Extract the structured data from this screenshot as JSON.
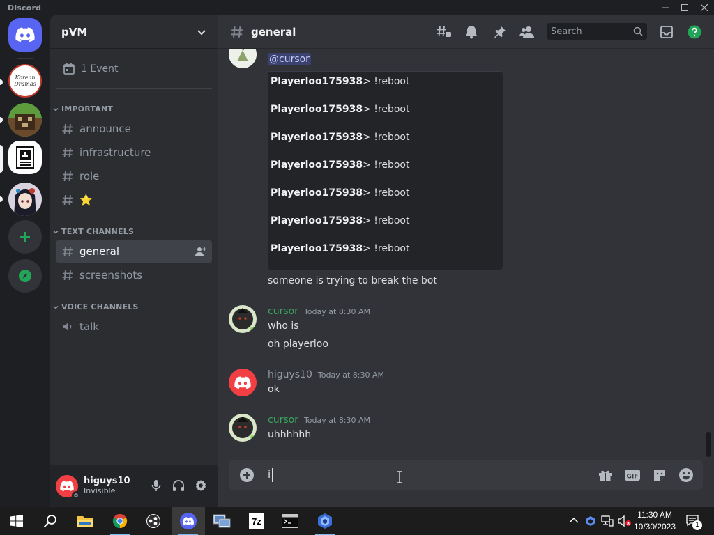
{
  "window": {
    "title": "Discord"
  },
  "colors": {
    "blurple": "#5865f2",
    "green": "#23a559",
    "red": "#f23f43",
    "cursor_author": "#3ba55c",
    "higuys_author": "#949ba4"
  },
  "rail": {
    "servers": [
      {
        "name": "Korean Dramas",
        "icon_text": "Korean Dramas",
        "unread": true
      },
      {
        "name": "pixel-creeper-server",
        "icon_text": "",
        "unread": true
      },
      {
        "name": "pVM",
        "icon_text": "",
        "selected": true
      },
      {
        "name": "anime-server",
        "icon_text": "",
        "unread": true
      }
    ],
    "add_server": "add-server-icon",
    "explore": "compass-icon"
  },
  "sidebar": {
    "server_name": "pVM",
    "events_label": "1 Event",
    "categories": [
      {
        "name": "IMPORTANT",
        "channels": [
          {
            "name": "announce"
          },
          {
            "name": "infrastructure"
          },
          {
            "name": "role"
          },
          {
            "name": "⭐"
          }
        ]
      },
      {
        "name": "TEXT CHANNELS",
        "channels": [
          {
            "name": "general",
            "active": true
          },
          {
            "name": "screenshots"
          }
        ]
      },
      {
        "name": "VOICE CHANNELS",
        "channels": [
          {
            "name": "talk",
            "voice": true
          }
        ]
      }
    ]
  },
  "user": {
    "name": "higuys10",
    "status": "Invisible"
  },
  "header": {
    "channel": "general",
    "search_placeholder": "Search"
  },
  "messages": {
    "first": {
      "mention": "@cursor",
      "code_lines": [
        {
          "user": "Playerloo175938",
          "cmd": "> !reboot"
        },
        {
          "user": "Playerloo175938",
          "cmd": "> !reboot"
        },
        {
          "user": "Playerloo175938",
          "cmd": "> !reboot"
        },
        {
          "user": "Playerloo175938",
          "cmd": "> !reboot"
        },
        {
          "user": "Playerloo175938",
          "cmd": "> !reboot"
        },
        {
          "user": "Playerloo175938",
          "cmd": "> !reboot"
        },
        {
          "user": "Playerloo175938",
          "cmd": "> !reboot"
        }
      ],
      "followup": "someone is trying to break the bot"
    },
    "groups": [
      {
        "author": "cursor",
        "timestamp": "Today at 8:30 AM",
        "lines": [
          "who is",
          "oh playerloo"
        ]
      },
      {
        "author": "higuys10",
        "timestamp": "Today at 8:30 AM",
        "lines": [
          "ok"
        ]
      },
      {
        "author": "cursor",
        "timestamp": "Today at 8:30 AM",
        "lines": [
          "uhhhhhh"
        ]
      }
    ]
  },
  "composer": {
    "draft": "i"
  },
  "taskbar": {
    "apps": [
      "start-icon",
      "search-icon",
      "file-explorer-icon",
      "chrome-icon",
      "obs-icon",
      "discord-icon",
      "network-icon",
      "7zip-icon",
      "terminal-icon",
      "copilot-icon"
    ],
    "seven_zip_label": "7z",
    "time": "11:30 AM",
    "date": "10/30/2023",
    "notification_count": "1"
  }
}
